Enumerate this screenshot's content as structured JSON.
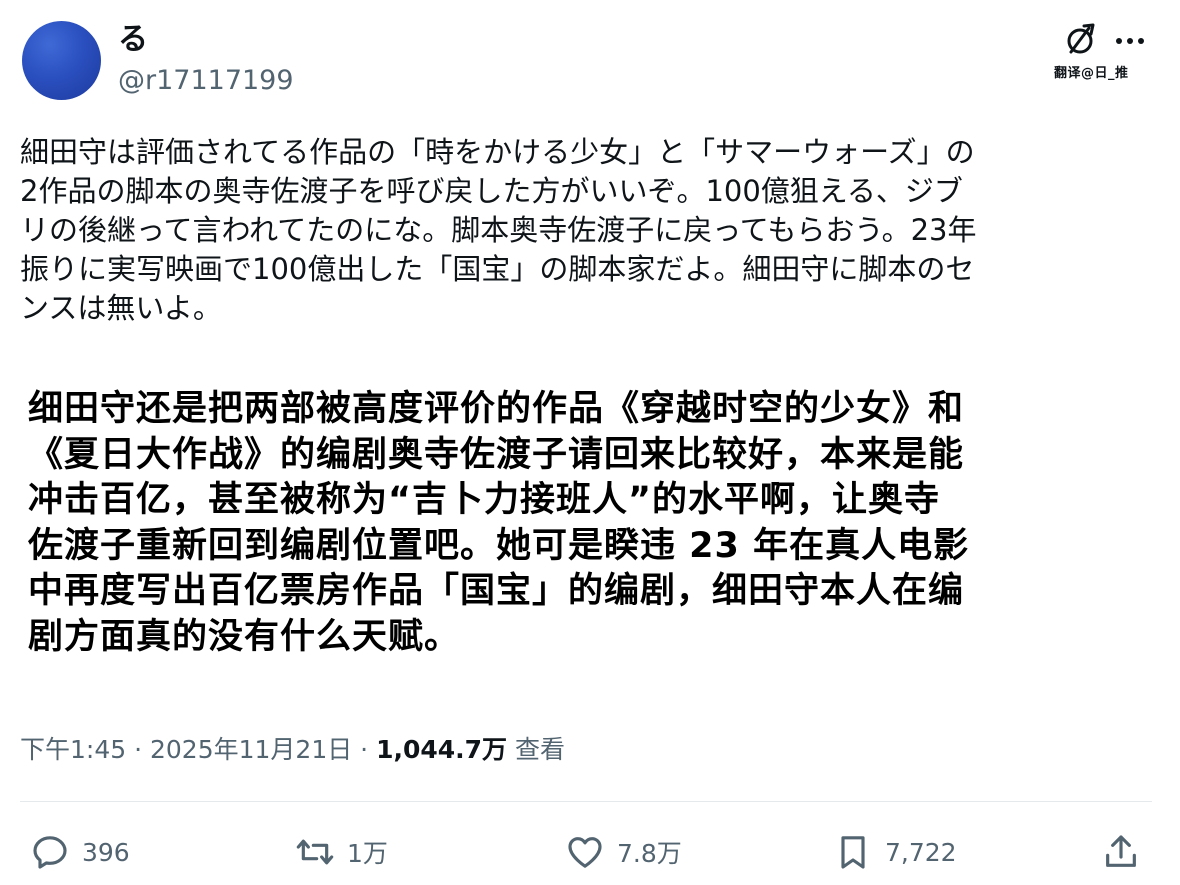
{
  "author": {
    "display_name": "る",
    "handle": "@r17117199"
  },
  "toolbar": {
    "translate_label": "翻译@日_推"
  },
  "original_lines": [
    "細田守は評価されてる作品の「時をかける少女」と「サマーウォーズ」の",
    "2作品の脚本の奥寺佐渡子を呼び戻した方がいいぞ。100億狙える、ジブ",
    "リの後継って言われてたのにな。脚本奥寺佐渡子に戻ってもらおう。23年",
    "振りに実写映画で100億出した「国宝」の脚本家だよ。細田守に脚本のセ",
    "ンスは無いよ。"
  ],
  "translation_lines": [
    "细田守还是把两部被高度评价的作品《穿越时空的少女》和",
    "《夏日大作战》的编剧奥寺佐渡子请回来比较好，本来是能",
    "冲击百亿，甚至被称为“吉卜力接班人”的水平啊，让奥寺",
    "佐渡子重新回到编剧位置吧。她可是睽违 23 年在真人电影",
    "中再度写出百亿票房作品「国宝」的编剧，细田守本人在编",
    "剧方面真的没有什么天赋。"
  ],
  "meta": {
    "time": "下午1:45",
    "sep1": " · ",
    "date": "2025年11月21日",
    "sep2": " · ",
    "views": "1,044.7万",
    "views_label": " 查看"
  },
  "actions": {
    "replies": "396",
    "reposts": "1万",
    "likes": "7.8万",
    "bookmarks": "7,722"
  },
  "icons": {
    "reply": "reply-icon",
    "repost": "repost-icon",
    "like": "heart-icon",
    "bookmark": "bookmark-icon",
    "share": "share-icon",
    "more": "more-icon",
    "translate": "translate-icon"
  },
  "colors": {
    "text": "#0f1419",
    "secondary": "#536471",
    "avatar": "#2a4fbf"
  }
}
